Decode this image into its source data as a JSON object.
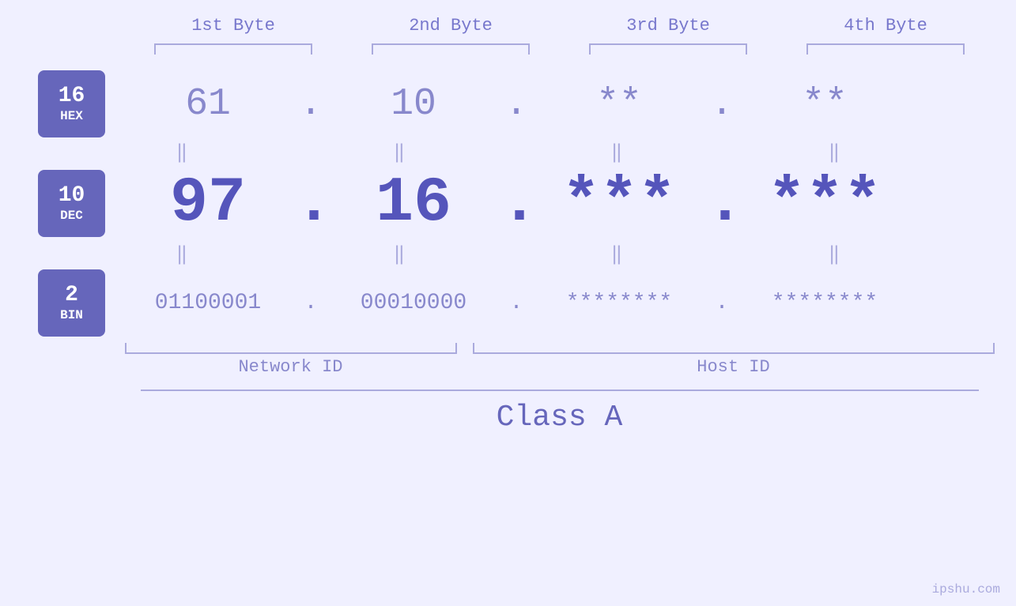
{
  "headers": {
    "byte1": "1st Byte",
    "byte2": "2nd Byte",
    "byte3": "3rd Byte",
    "byte4": "4th Byte"
  },
  "badges": {
    "hex": {
      "number": "16",
      "label": "HEX"
    },
    "dec": {
      "number": "10",
      "label": "DEC"
    },
    "bin": {
      "number": "2",
      "label": "BIN"
    }
  },
  "hex_values": {
    "b1": "61",
    "b2": "10",
    "b3": "**",
    "b4": "**"
  },
  "dec_values": {
    "b1": "97",
    "b2": "16",
    "b3": "***",
    "b4": "***"
  },
  "bin_values": {
    "b1": "01100001",
    "b2": "00010000",
    "b3": "********",
    "b4": "********"
  },
  "labels": {
    "network_id": "Network ID",
    "host_id": "Host ID",
    "class": "Class A"
  },
  "dots": {
    "dot": "."
  },
  "equals": {
    "sym": "‖"
  },
  "watermark": "ipshu.com"
}
